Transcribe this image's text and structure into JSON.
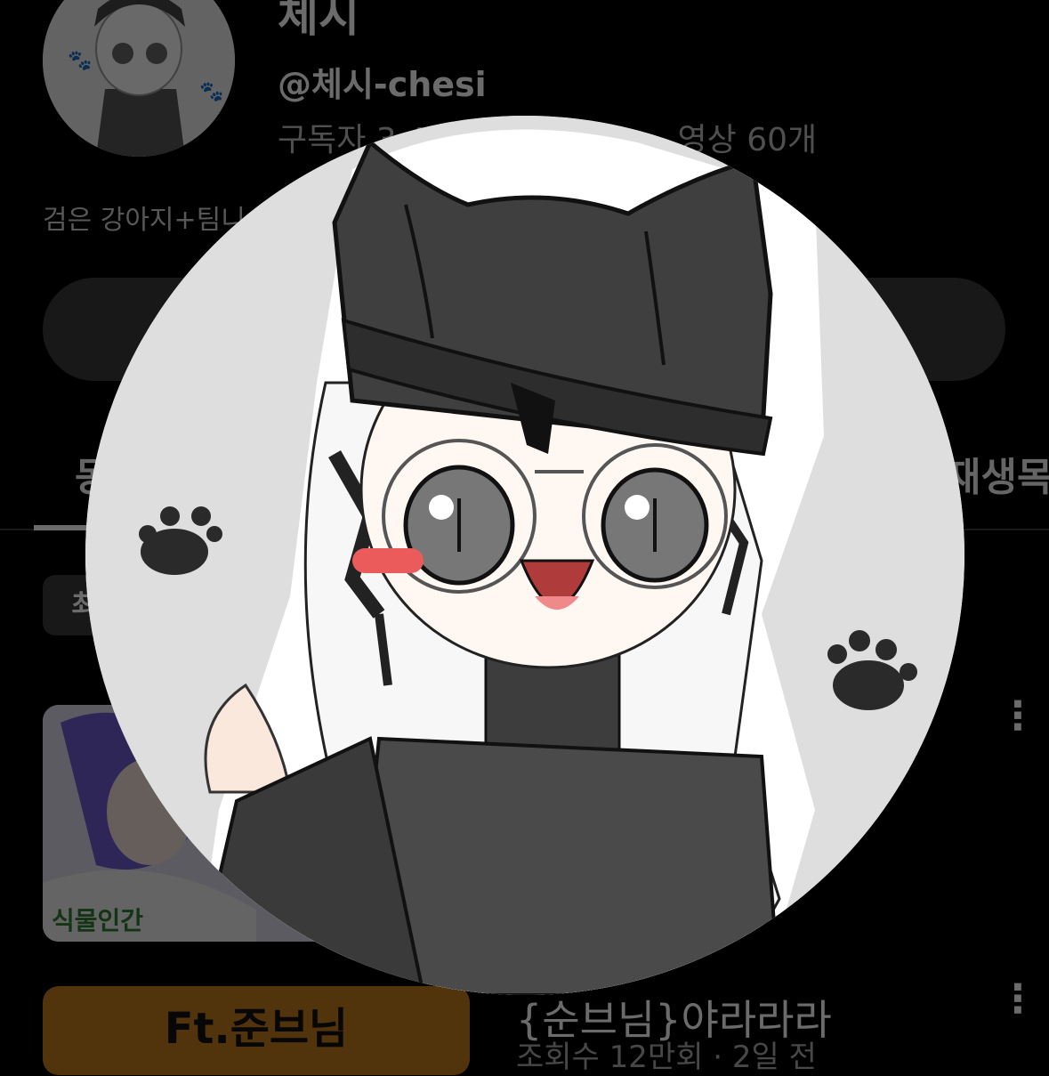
{
  "channel": {
    "name": "체시",
    "handle": "@체시-chesi",
    "stats_prefix": "구독자 3.4",
    "stats_suffix": "영상 60개",
    "description": "검은 강아지+팀니"
  },
  "tabs": {
    "first_partial": "동",
    "last_partial": "재생목"
  },
  "chips": {
    "first_partial": "최"
  },
  "videos": [
    {
      "thumb_caption": "식물인간",
      "more_icon": "more-vert-icon"
    },
    {
      "thumb_caption": "Ft.준브님",
      "title": "{순브님}야라라라",
      "meta": "조회수 12만회 · 2일 전",
      "more_icon": "more-vert-icon"
    }
  ],
  "colors": {
    "background": "#000000",
    "button": "#3a3a3a",
    "thumb2_bg": "#c07a1c",
    "overlay_bg": "#dedede",
    "hat": "#3f3f3f"
  }
}
